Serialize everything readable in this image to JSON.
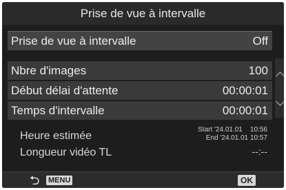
{
  "title": "Prise de vue à intervalle",
  "mode_row": {
    "label": "Prise de vue à intervalle",
    "value": "Off"
  },
  "settings": [
    {
      "label": "Nbre d'images",
      "value": "100"
    },
    {
      "label": "Début délai d'attente",
      "value": "00:00:01"
    },
    {
      "label": "Temps d'intervalle",
      "value": "00:00:01"
    }
  ],
  "estimated": {
    "label": "Heure estimée",
    "start": "Start '24.01.01    10:56",
    "end": "End '24.01.01 10:57"
  },
  "tl_video": {
    "label": "Longueur vidéo TL",
    "value": "--:--"
  },
  "footer": {
    "menu_label": "MENU",
    "ok_label": "OK"
  },
  "icons": {
    "back": "back-arrow-icon",
    "scroll_up": "chevron-up-icon",
    "scroll_down": "chevron-down-icon"
  }
}
